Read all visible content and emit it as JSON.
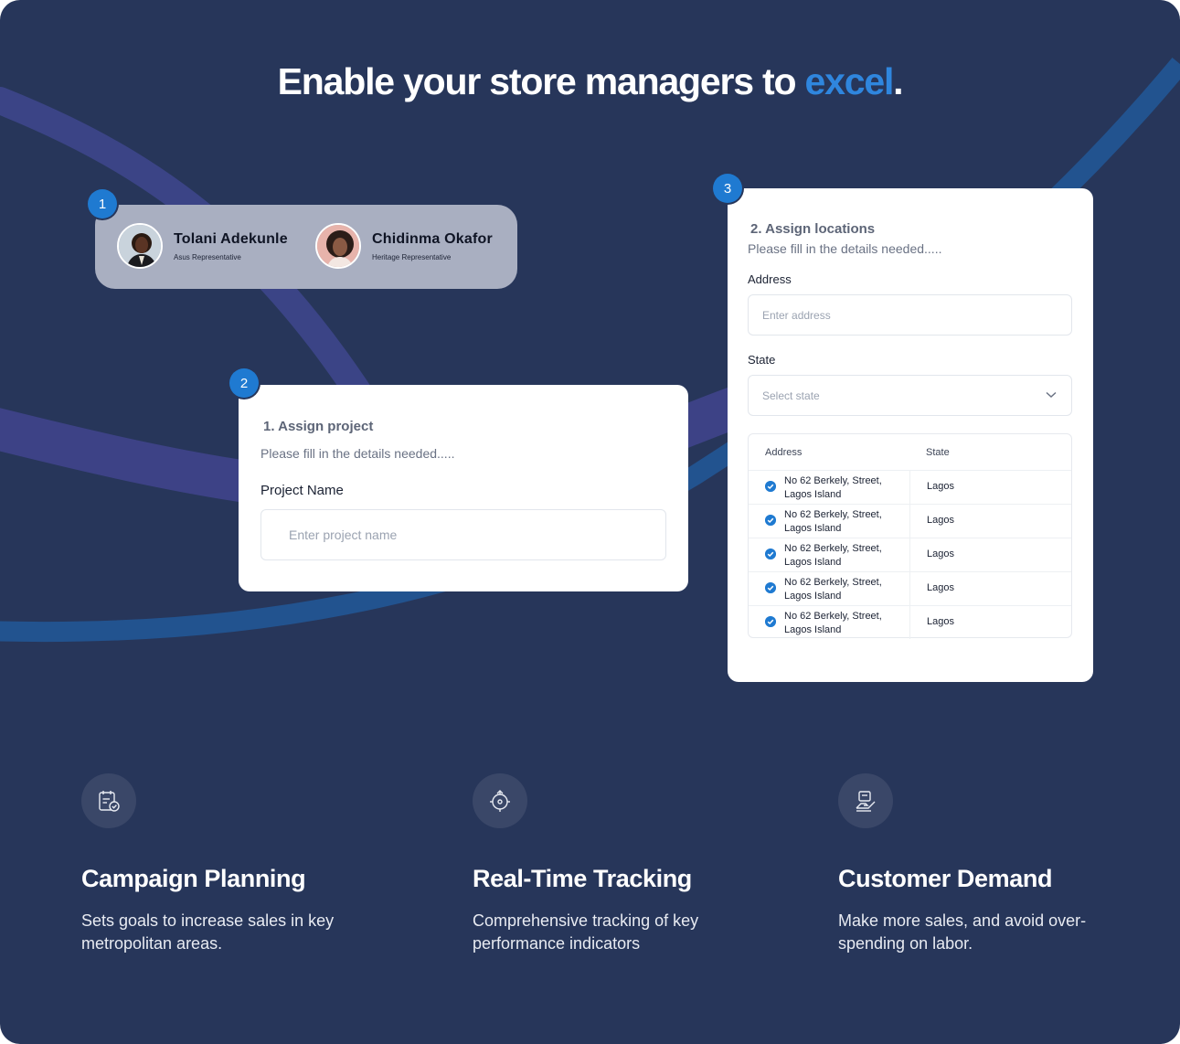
{
  "headline": {
    "text": "Enable your store managers to ",
    "accent": "excel",
    "end": "."
  },
  "steps": [
    "1",
    "2",
    "3"
  ],
  "people": [
    {
      "name": "Tolani Adekunle",
      "role": "Asus Representative"
    },
    {
      "name": "Chidinma Okafor",
      "role": "Heritage Representative"
    }
  ],
  "project_card": {
    "title": "1. Assign project",
    "subtitle": "Please fill in the details needed.....",
    "field_label": "Project Name",
    "placeholder": "Enter project name"
  },
  "locations_card": {
    "title": "2. Assign locations",
    "subtitle": "Please fill in the details needed.....",
    "address_label": "Address",
    "address_placeholder": "Enter address",
    "state_label": "State",
    "state_placeholder": "Select state",
    "table": {
      "headers": [
        "Address",
        "State"
      ],
      "rows": [
        {
          "address": "No 62 Berkely, Street, Lagos Island",
          "state": "Lagos"
        },
        {
          "address": "No 62 Berkely, Street, Lagos Island",
          "state": "Lagos"
        },
        {
          "address": "No 62 Berkely, Street, Lagos Island",
          "state": "Lagos"
        },
        {
          "address": "No 62 Berkely, Street, Lagos Island",
          "state": "Lagos"
        },
        {
          "address": "No 62 Berkely, Street, Lagos Island",
          "state": "Lagos"
        }
      ]
    }
  },
  "features": [
    {
      "icon": "calendar-check-icon",
      "title": "Campaign  Planning",
      "description": "Sets goals to increase sales in key metropolitan areas."
    },
    {
      "icon": "tracking-target-icon",
      "title": "Real-Time Tracking",
      "description": "Comprehensive tracking of key performance indicators"
    },
    {
      "icon": "hand-card-icon",
      "title": "Customer Demand",
      "description": "Make more sales, and avoid over-spending on labor."
    }
  ],
  "colors": {
    "background": "#27365a",
    "accent": "#2f86de",
    "badge": "#1f7ad1",
    "people_card": "#a9afc1"
  }
}
